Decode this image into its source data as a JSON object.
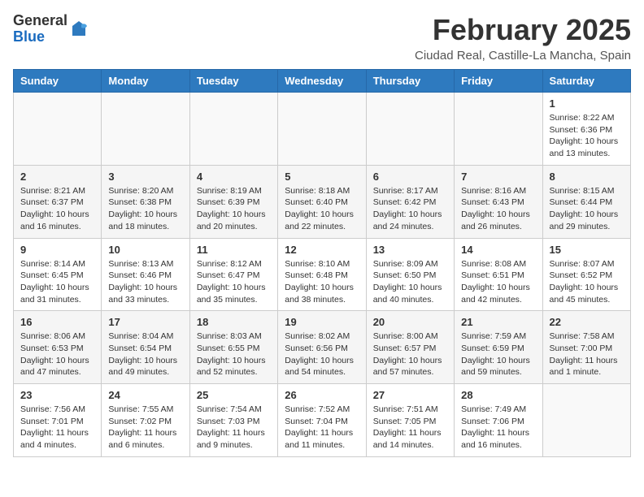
{
  "logo": {
    "general": "General",
    "blue": "Blue"
  },
  "title": {
    "month_year": "February 2025",
    "location": "Ciudad Real, Castille-La Mancha, Spain"
  },
  "weekdays": [
    "Sunday",
    "Monday",
    "Tuesday",
    "Wednesday",
    "Thursday",
    "Friday",
    "Saturday"
  ],
  "weeks": [
    [
      {
        "day": "",
        "info": ""
      },
      {
        "day": "",
        "info": ""
      },
      {
        "day": "",
        "info": ""
      },
      {
        "day": "",
        "info": ""
      },
      {
        "day": "",
        "info": ""
      },
      {
        "day": "",
        "info": ""
      },
      {
        "day": "1",
        "info": "Sunrise: 8:22 AM\nSunset: 6:36 PM\nDaylight: 10 hours\nand 13 minutes."
      }
    ],
    [
      {
        "day": "2",
        "info": "Sunrise: 8:21 AM\nSunset: 6:37 PM\nDaylight: 10 hours\nand 16 minutes."
      },
      {
        "day": "3",
        "info": "Sunrise: 8:20 AM\nSunset: 6:38 PM\nDaylight: 10 hours\nand 18 minutes."
      },
      {
        "day": "4",
        "info": "Sunrise: 8:19 AM\nSunset: 6:39 PM\nDaylight: 10 hours\nand 20 minutes."
      },
      {
        "day": "5",
        "info": "Sunrise: 8:18 AM\nSunset: 6:40 PM\nDaylight: 10 hours\nand 22 minutes."
      },
      {
        "day": "6",
        "info": "Sunrise: 8:17 AM\nSunset: 6:42 PM\nDaylight: 10 hours\nand 24 minutes."
      },
      {
        "day": "7",
        "info": "Sunrise: 8:16 AM\nSunset: 6:43 PM\nDaylight: 10 hours\nand 26 minutes."
      },
      {
        "day": "8",
        "info": "Sunrise: 8:15 AM\nSunset: 6:44 PM\nDaylight: 10 hours\nand 29 minutes."
      }
    ],
    [
      {
        "day": "9",
        "info": "Sunrise: 8:14 AM\nSunset: 6:45 PM\nDaylight: 10 hours\nand 31 minutes."
      },
      {
        "day": "10",
        "info": "Sunrise: 8:13 AM\nSunset: 6:46 PM\nDaylight: 10 hours\nand 33 minutes."
      },
      {
        "day": "11",
        "info": "Sunrise: 8:12 AM\nSunset: 6:47 PM\nDaylight: 10 hours\nand 35 minutes."
      },
      {
        "day": "12",
        "info": "Sunrise: 8:10 AM\nSunset: 6:48 PM\nDaylight: 10 hours\nand 38 minutes."
      },
      {
        "day": "13",
        "info": "Sunrise: 8:09 AM\nSunset: 6:50 PM\nDaylight: 10 hours\nand 40 minutes."
      },
      {
        "day": "14",
        "info": "Sunrise: 8:08 AM\nSunset: 6:51 PM\nDaylight: 10 hours\nand 42 minutes."
      },
      {
        "day": "15",
        "info": "Sunrise: 8:07 AM\nSunset: 6:52 PM\nDaylight: 10 hours\nand 45 minutes."
      }
    ],
    [
      {
        "day": "16",
        "info": "Sunrise: 8:06 AM\nSunset: 6:53 PM\nDaylight: 10 hours\nand 47 minutes."
      },
      {
        "day": "17",
        "info": "Sunrise: 8:04 AM\nSunset: 6:54 PM\nDaylight: 10 hours\nand 49 minutes."
      },
      {
        "day": "18",
        "info": "Sunrise: 8:03 AM\nSunset: 6:55 PM\nDaylight: 10 hours\nand 52 minutes."
      },
      {
        "day": "19",
        "info": "Sunrise: 8:02 AM\nSunset: 6:56 PM\nDaylight: 10 hours\nand 54 minutes."
      },
      {
        "day": "20",
        "info": "Sunrise: 8:00 AM\nSunset: 6:57 PM\nDaylight: 10 hours\nand 57 minutes."
      },
      {
        "day": "21",
        "info": "Sunrise: 7:59 AM\nSunset: 6:59 PM\nDaylight: 10 hours\nand 59 minutes."
      },
      {
        "day": "22",
        "info": "Sunrise: 7:58 AM\nSunset: 7:00 PM\nDaylight: 11 hours\nand 1 minute."
      }
    ],
    [
      {
        "day": "23",
        "info": "Sunrise: 7:56 AM\nSunset: 7:01 PM\nDaylight: 11 hours\nand 4 minutes."
      },
      {
        "day": "24",
        "info": "Sunrise: 7:55 AM\nSunset: 7:02 PM\nDaylight: 11 hours\nand 6 minutes."
      },
      {
        "day": "25",
        "info": "Sunrise: 7:54 AM\nSunset: 7:03 PM\nDaylight: 11 hours\nand 9 minutes."
      },
      {
        "day": "26",
        "info": "Sunrise: 7:52 AM\nSunset: 7:04 PM\nDaylight: 11 hours\nand 11 minutes."
      },
      {
        "day": "27",
        "info": "Sunrise: 7:51 AM\nSunset: 7:05 PM\nDaylight: 11 hours\nand 14 minutes."
      },
      {
        "day": "28",
        "info": "Sunrise: 7:49 AM\nSunset: 7:06 PM\nDaylight: 11 hours\nand 16 minutes."
      },
      {
        "day": "",
        "info": ""
      }
    ]
  ]
}
